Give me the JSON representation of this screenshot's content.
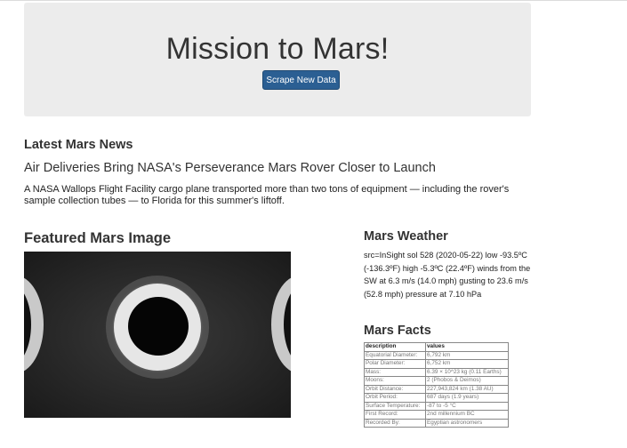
{
  "jumbotron": {
    "title": "Mission to Mars!",
    "button_label": "Scrape New Data",
    "button_color": "#2b5f93"
  },
  "news": {
    "section_title": "Latest Mars News",
    "title": "Air Deliveries Bring NASA's Perseverance Mars Rover Closer to Launch",
    "paragraph": "A NASA Wallops Flight Facility cargo plane transported more than two tons of equipment — including the rover's sample collection tubes — to Florida for this summer's liftoff."
  },
  "featured": {
    "section_title": "Featured Mars Image"
  },
  "weather": {
    "section_title": "Mars Weather",
    "text": "src=InSight sol 528 (2020-05-22) low -93.5ºC (-136.3ºF) high -5.3ºC (22.4ºF) winds from the SW at 6.3 m/s (14.0 mph) gusting to 23.6 m/s (52.8 mph) pressure at 7.10 hPa"
  },
  "facts": {
    "section_title": "Mars Facts",
    "headers": [
      "description",
      "values"
    ],
    "rows": [
      [
        "Equatorial Diameter:",
        "6,792 km"
      ],
      [
        "Polar Diameter:",
        "6,752 km"
      ],
      [
        "Mass:",
        "6.39 × 10^23 kg (0.11 Earths)"
      ],
      [
        "Moons:",
        "2 (Phobos & Deimos)"
      ],
      [
        "Orbit Distance:",
        "227,943,824 km (1.38 AU)"
      ],
      [
        "Orbit Period:",
        "687 days (1.9 years)"
      ],
      [
        "Surface Temperature:",
        "-87 to -5 °C"
      ],
      [
        "First Record:",
        "2nd millennium BC"
      ],
      [
        "Recorded By:",
        "Egyptian astronomers"
      ]
    ]
  }
}
